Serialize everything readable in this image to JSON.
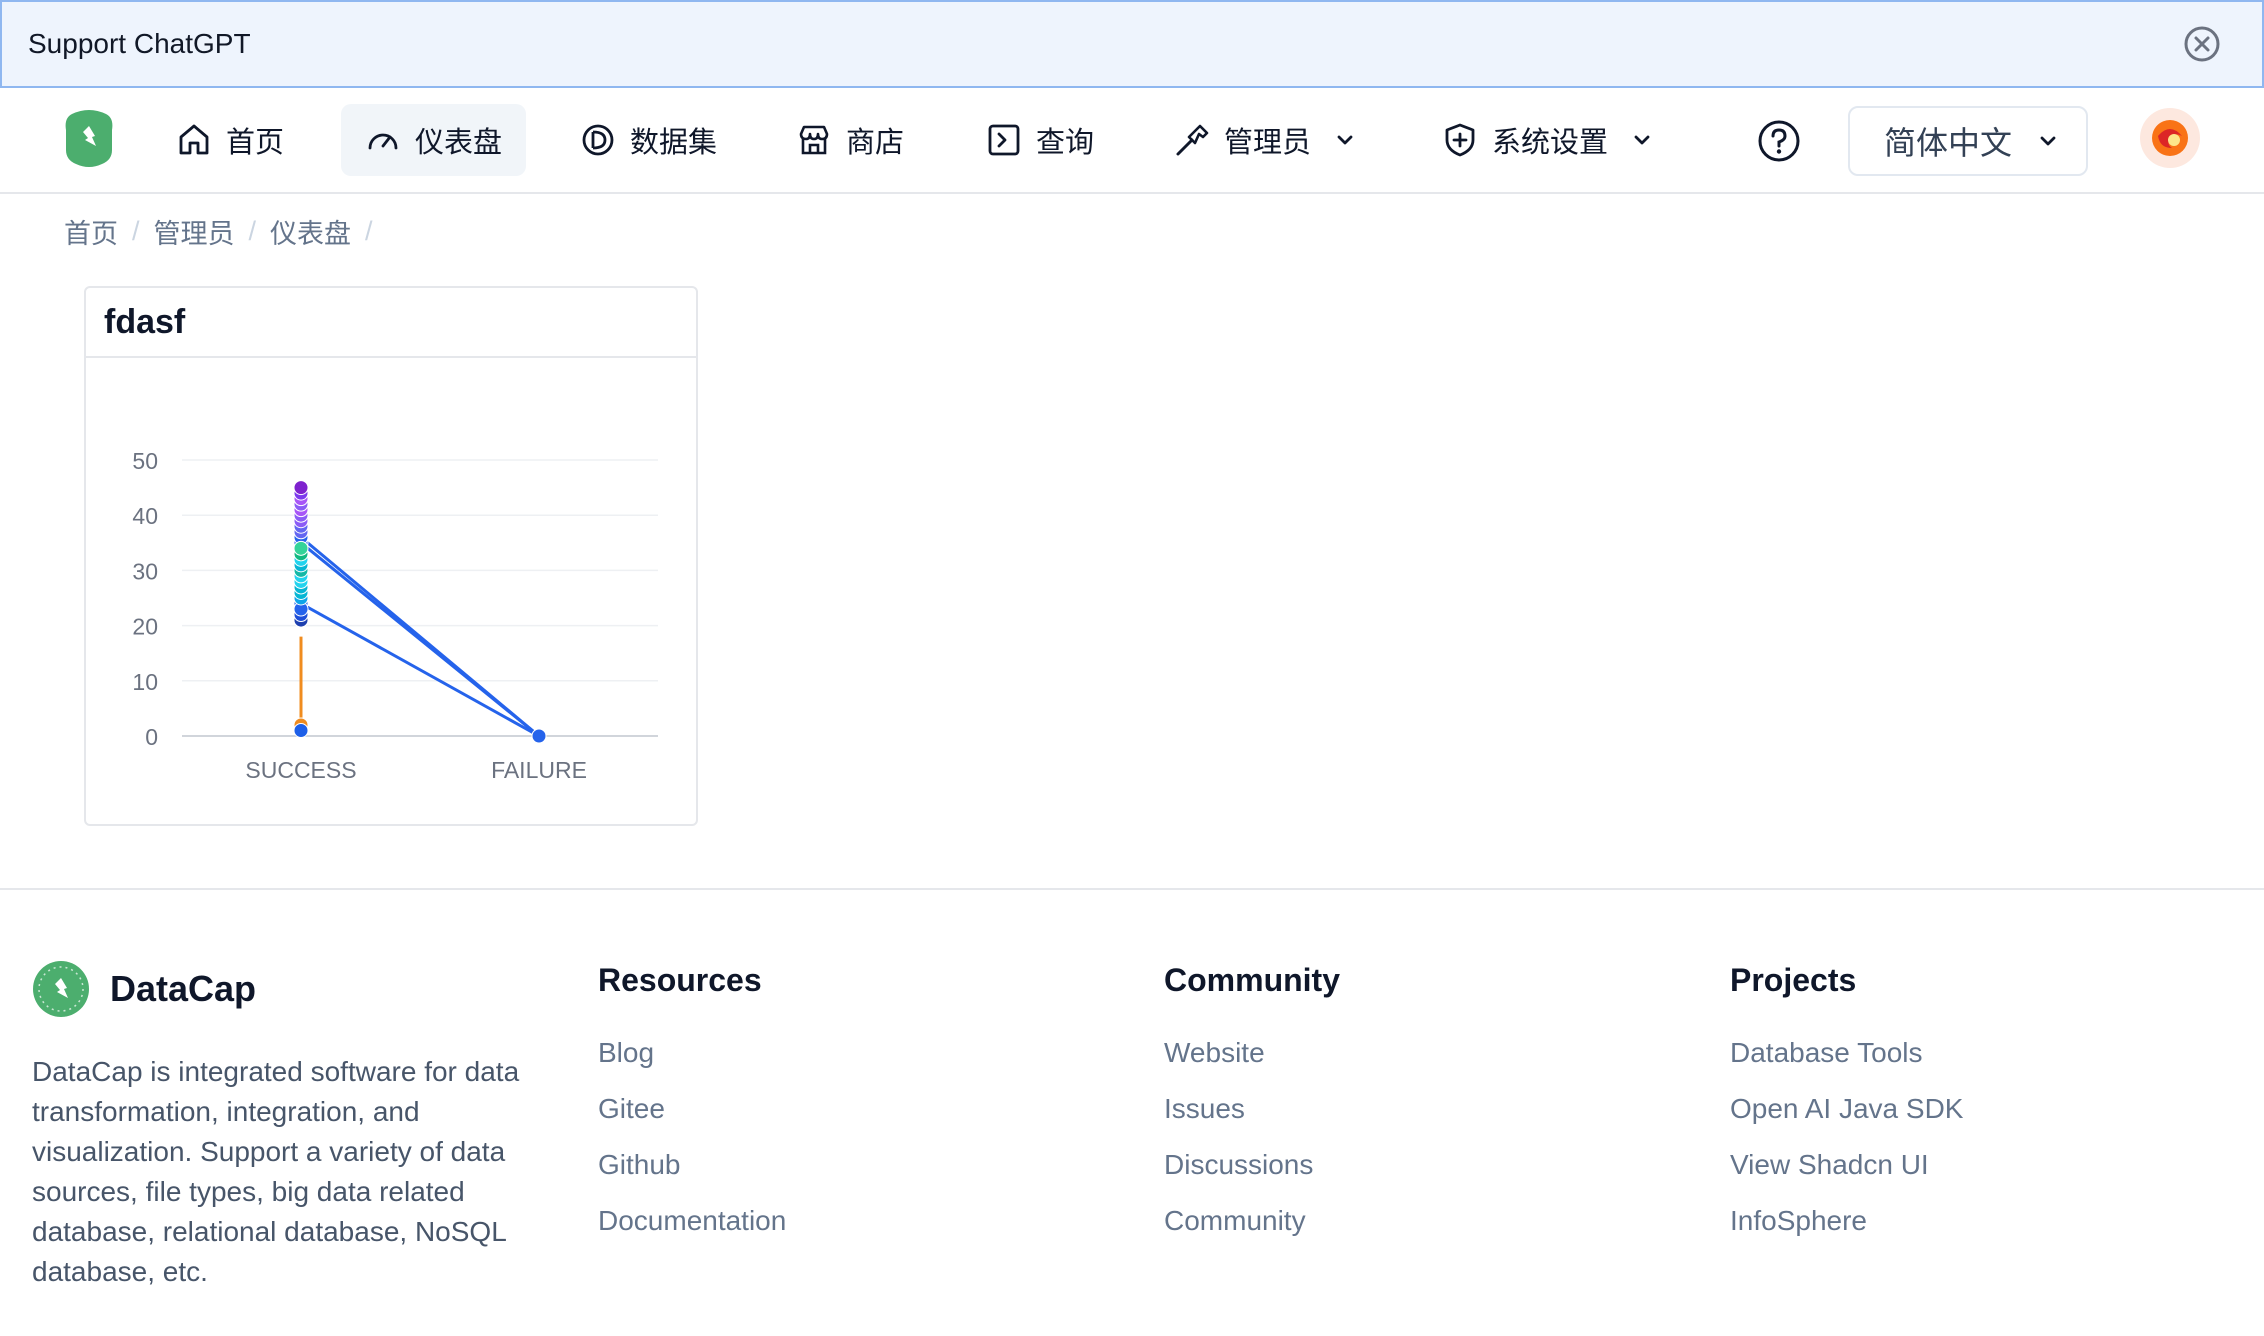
{
  "banner": {
    "text": "Support ChatGPT"
  },
  "nav": {
    "items": [
      {
        "label": "首页",
        "icon": "home-icon"
      },
      {
        "label": "仪表盘",
        "icon": "gauge-icon"
      },
      {
        "label": "数据集",
        "icon": "dataset-icon"
      },
      {
        "label": "商店",
        "icon": "store-icon"
      },
      {
        "label": "查询",
        "icon": "terminal-icon"
      },
      {
        "label": "管理员",
        "icon": "hammer-icon"
      },
      {
        "label": "系统设置",
        "icon": "shield-plus-icon"
      }
    ],
    "language": "简体中文"
  },
  "breadcrumb": [
    "首页",
    "管理员",
    "仪表盘"
  ],
  "card": {
    "title": "fdasf"
  },
  "chart_data": {
    "type": "line",
    "categories": [
      "SUCCESS",
      "FAILURE"
    ],
    "yticks": [
      0,
      10,
      20,
      30,
      40,
      50
    ],
    "ylim": [
      0,
      50
    ],
    "grid": true,
    "series": [
      {
        "color": "#f08c1f",
        "values": [
          2,
          null
        ]
      },
      {
        "color": "#1d5fe8",
        "values": [
          1,
          null
        ]
      },
      {
        "color": "#2563eb",
        "values": [
          24,
          0
        ]
      },
      {
        "color": "#2563eb",
        "values": [
          35,
          0
        ]
      },
      {
        "color": "#2563eb",
        "values": [
          36,
          0
        ]
      },
      {
        "color": "#1e40af",
        "values": [
          21,
          null
        ]
      },
      {
        "color": "#1d4ed8",
        "values": [
          22,
          null
        ]
      },
      {
        "color": "#2563eb",
        "values": [
          23,
          null
        ]
      },
      {
        "color": "#0ea5e9",
        "values": [
          25,
          null
        ]
      },
      {
        "color": "#06b6d4",
        "values": [
          26,
          null
        ]
      },
      {
        "color": "#06b6d4",
        "values": [
          27,
          null
        ]
      },
      {
        "color": "#22d3ee",
        "values": [
          28,
          null
        ]
      },
      {
        "color": "#22d3ee",
        "values": [
          29,
          null
        ]
      },
      {
        "color": "#14b8a6",
        "values": [
          30,
          null
        ]
      },
      {
        "color": "#06b6d4",
        "values": [
          31,
          null
        ]
      },
      {
        "color": "#22d3ee",
        "values": [
          32,
          null
        ]
      },
      {
        "color": "#10b981",
        "values": [
          33,
          null
        ]
      },
      {
        "color": "#34d399",
        "values": [
          34,
          null
        ]
      },
      {
        "color": "#6366f1",
        "values": [
          37,
          null
        ]
      },
      {
        "color": "#6366f1",
        "values": [
          38,
          null
        ]
      },
      {
        "color": "#8b5cf6",
        "values": [
          39,
          null
        ]
      },
      {
        "color": "#8b5cf6",
        "values": [
          40,
          null
        ]
      },
      {
        "color": "#a855f7",
        "values": [
          41,
          null
        ]
      },
      {
        "color": "#8b5cf6",
        "values": [
          42,
          null
        ]
      },
      {
        "color": "#a855f7",
        "values": [
          43,
          null
        ]
      },
      {
        "color": "#7c3aed",
        "values": [
          44,
          null
        ]
      },
      {
        "color": "#7e22ce",
        "values": [
          45,
          null
        ]
      }
    ]
  },
  "footer": {
    "brand": "DataCap",
    "description": "DataCap is integrated software for data transformation, integration, and visualization. Support a variety of data sources, file types, big data related database, relational database, NoSQL database, etc.",
    "columns": [
      {
        "title": "Resources",
        "links": [
          "Blog",
          "Gitee",
          "Github",
          "Documentation"
        ]
      },
      {
        "title": "Community",
        "links": [
          "Website",
          "Issues",
          "Discussions",
          "Community"
        ]
      },
      {
        "title": "Projects",
        "links": [
          "Database Tools",
          "Open AI Java SDK",
          "View Shadcn UI",
          "InfoSphere"
        ]
      }
    ]
  }
}
